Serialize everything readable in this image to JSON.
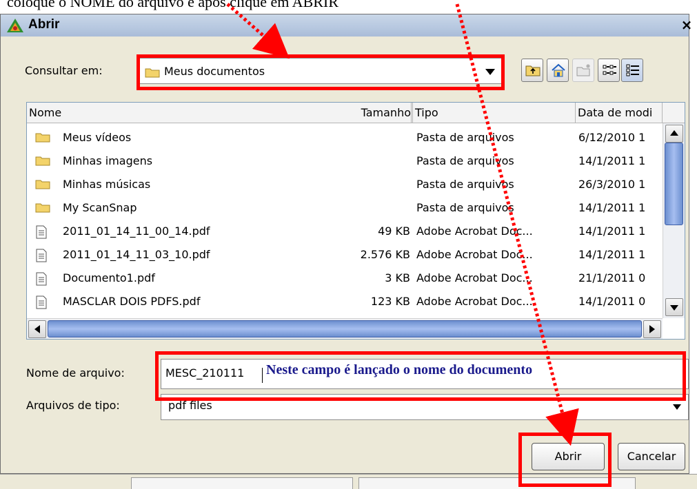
{
  "caption": "coloque o NOME do arquivo e após clique em ABRIR",
  "window": {
    "title": "Abrir",
    "close": "×"
  },
  "look_in": {
    "label": "Consultar em:",
    "value": "Meus documentos"
  },
  "toolbar": {
    "icons": [
      "up-folder-icon",
      "home-icon",
      "new-folder-icon",
      "list-view-icon",
      "details-view-icon"
    ]
  },
  "columns": [
    "Nome",
    "Tamanho",
    "Tipo",
    "Data de modi"
  ],
  "files": [
    {
      "icon": "folder-icon",
      "name": "Meus vídeos",
      "size": "",
      "type": "Pasta de arquivos",
      "date": "6/12/2010 1"
    },
    {
      "icon": "folder-icon",
      "name": "Minhas imagens",
      "size": "",
      "type": "Pasta de arquivos",
      "date": "14/1/2011 1"
    },
    {
      "icon": "folder-icon",
      "name": "Minhas músicas",
      "size": "",
      "type": "Pasta de arquivos",
      "date": "26/3/2010 1"
    },
    {
      "icon": "folder-icon",
      "name": "My ScanSnap",
      "size": "",
      "type": "Pasta de arquivos",
      "date": "14/1/2011 1"
    },
    {
      "icon": "document-icon",
      "name": "2011_01_14_11_00_14.pdf",
      "size": "49 KB",
      "type": "Adobe Acrobat Doc...",
      "date": "14/1/2011 1"
    },
    {
      "icon": "document-icon",
      "name": "2011_01_14_11_03_10.pdf",
      "size": "2.576 KB",
      "type": "Adobe Acrobat Doc...",
      "date": "14/1/2011 1"
    },
    {
      "icon": "document-icon",
      "name": "Documento1.pdf",
      "size": "3 KB",
      "type": "Adobe Acrobat Doc...",
      "date": "21/1/2011 0"
    },
    {
      "icon": "document-icon",
      "name": "MASCLAR DOIS PDFS.pdf",
      "size": "123 KB",
      "type": "Adobe Acrobat Doc...",
      "date": "14/1/2011 0"
    }
  ],
  "filename": {
    "label": "Nome de arquivo:",
    "value": "MESC_210111"
  },
  "filetype": {
    "label": "Arquivos de tipo:",
    "value": "pdf files"
  },
  "annotation": "Neste campo é lançado o nome do documento",
  "buttons": {
    "open": "Abrir",
    "cancel": "Cancelar"
  },
  "colors": {
    "highlight": "#ff0000",
    "annotation_text": "#1a1a8c"
  }
}
